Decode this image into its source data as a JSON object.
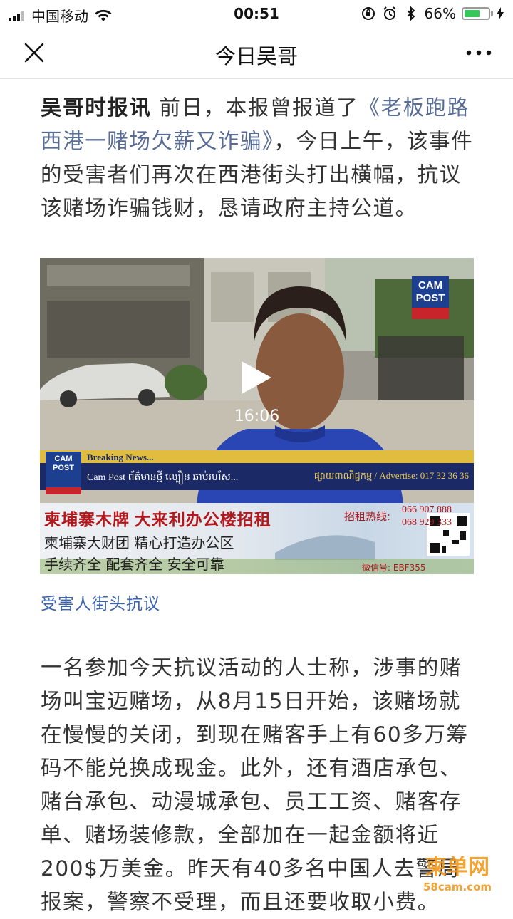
{
  "status_bar": {
    "carrier": "中国移动",
    "time": "00:51",
    "battery_percent": "66%",
    "battery_level": 0.66
  },
  "nav": {
    "title": "今日吴哥"
  },
  "article": {
    "lead_bold": "吴哥时报讯",
    "lead_text1": " 前日，本报曾报道了",
    "lead_link": "《老板跑路西港一赌场欠薪又诈骗》",
    "lead_text2": "，今日上午，该事件的受害者们再次在西港街头打出横幅，抗议该赌场诈骗钱财，恳请政府主持公道。",
    "video": {
      "duration": "16:06",
      "logo_line1": "CAM",
      "logo_line2": "POST",
      "breaking": "Breaking News...",
      "ticker": "Cam Post ព័ត៌មានថ្មី ល្បឿន ឆាប់រហ័ស...",
      "advertise": "ផ្សាយពាណិជ្ជកម្ម / Advertise: 017 32 36 36"
    },
    "ad": {
      "headline": "柬埔寨木牌 大来利办公楼招租",
      "hotline_label": "招租热线:",
      "phone1": "066 907 888",
      "phone2": "068 929 333",
      "line2": "柬埔寨大财团 精心打造办公区",
      "line3": "手续齐全 配套齐全 安全可靠",
      "wechat": "微信号: EBF355"
    },
    "caption": "受害人街头抗议",
    "body": "一名参加今天抗议活动的人士称，涉事的赌场叫宝迈赌场，从8月15日开始，该赌场就在慢慢的关闭，到现在赌客手上有60多万筹码不能兑换成现金。此外，还有酒店承包、赌台承包、动漫城承包、员工工资、赌客存单、赌场装修款，全部加在一起金额将近200$万美金。昨天有40多名中国人去警局报案，警察不受理，而且还要收取小费。"
  },
  "watermark": {
    "title": "柬单网",
    "url": "58cam.com"
  },
  "colors": {
    "link": "#576b95",
    "caption": "#3a63b0",
    "battery": "#35c759"
  }
}
